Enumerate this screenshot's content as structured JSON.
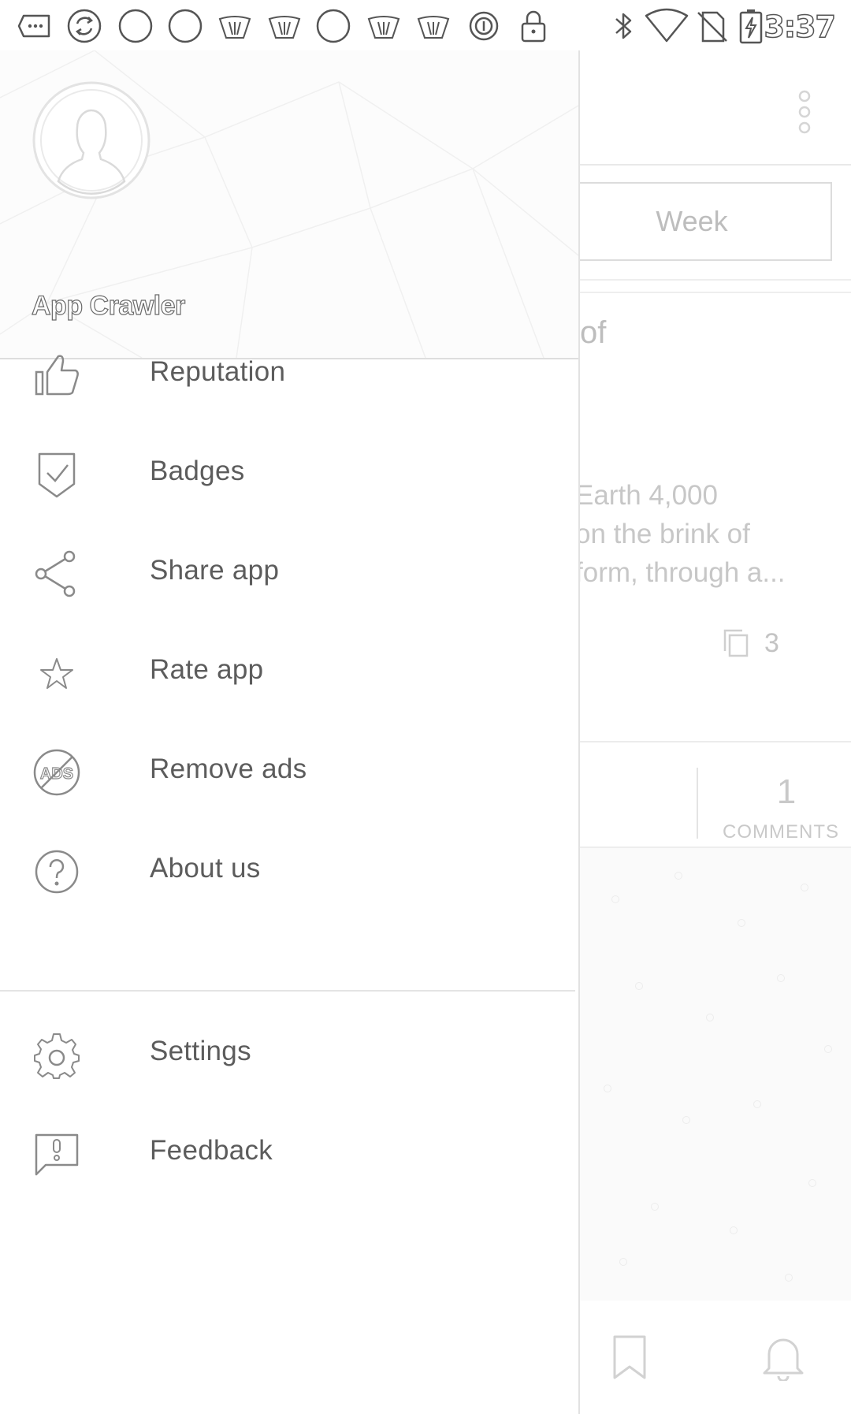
{
  "status_bar": {
    "time": "3:37",
    "left_icons": [
      "more-notif-icon",
      "sync-icon",
      "circle-notif-icon",
      "circle-notif-icon",
      "app-notif-icon",
      "app-notif-icon",
      "circle-notif-icon",
      "app-notif-icon",
      "app-notif-icon",
      "data-saver-icon",
      "lock-icon"
    ],
    "right_icons": [
      "bluetooth-icon",
      "wifi-icon",
      "no-sim-icon",
      "battery-charging-icon"
    ]
  },
  "drawer": {
    "user_name": "App Crawler",
    "avatar_icon": "user-avatar-icon",
    "menu_primary": [
      {
        "id": "reputation",
        "label": "Reputation",
        "icon": "thumbs-up-icon"
      },
      {
        "id": "badges",
        "label": "Badges",
        "icon": "badge-check-icon"
      },
      {
        "id": "share-app",
        "label": "Share app",
        "icon": "share-icon"
      },
      {
        "id": "rate-app",
        "label": "Rate app",
        "icon": "star-icon"
      },
      {
        "id": "remove-ads",
        "label": "Remove ads",
        "icon": "no-ads-icon"
      },
      {
        "id": "about-us",
        "label": "About us",
        "icon": "help-circle-icon"
      }
    ],
    "menu_secondary": [
      {
        "id": "settings",
        "label": "Settings",
        "icon": "gear-icon"
      },
      {
        "id": "feedback",
        "label": "Feedback",
        "icon": "feedback-icon"
      }
    ]
  },
  "background": {
    "period_button": "Week",
    "title_fragment": "of",
    "excerpt_lines": [
      "Earth 4,000",
      "on the brink of",
      "form, through a..."
    ],
    "copies_count": "3",
    "comments_count": "1",
    "comments_label": "COMMENTS"
  }
}
